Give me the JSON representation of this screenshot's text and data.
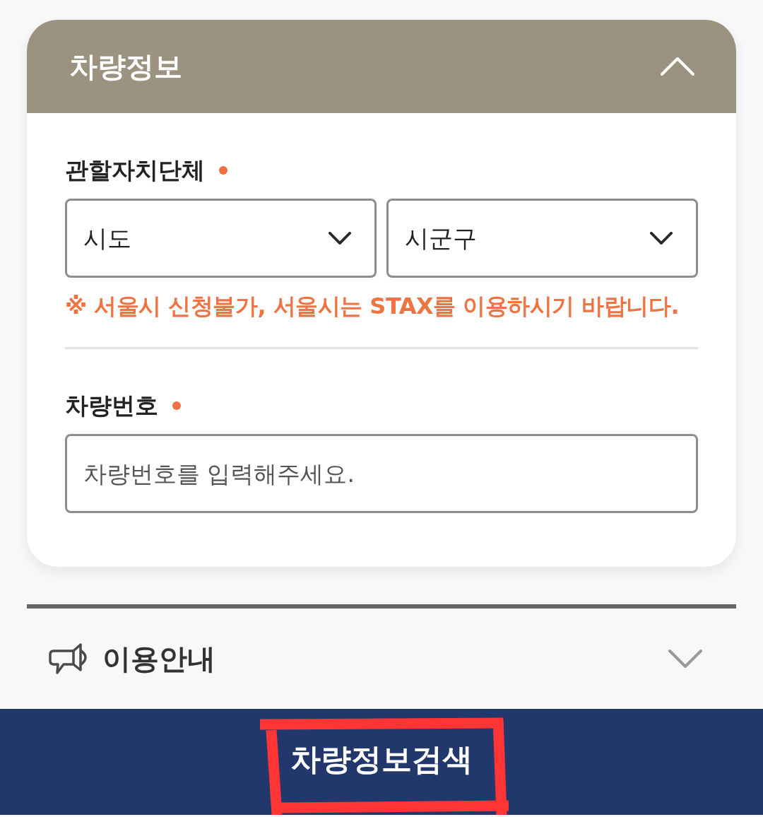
{
  "vehicle_info": {
    "title": "차량정보",
    "expanded": true,
    "fields": [
      {
        "kind": "select_pair",
        "label": "관할자치단체",
        "required": true,
        "selects": [
          {
            "value": "시도"
          },
          {
            "value": "시군구"
          }
        ],
        "notice": "※ 서울시 신청불가, 서울시는 STAX를 이용하시기 바랍니다."
      },
      {
        "kind": "text",
        "label": "차량번호",
        "required": true,
        "placeholder": "차량번호를 입력해주세요."
      }
    ]
  },
  "guide": {
    "title": "이용안내",
    "expanded": false
  },
  "submit": {
    "label": "차량정보검색",
    "highlighted": true
  }
}
